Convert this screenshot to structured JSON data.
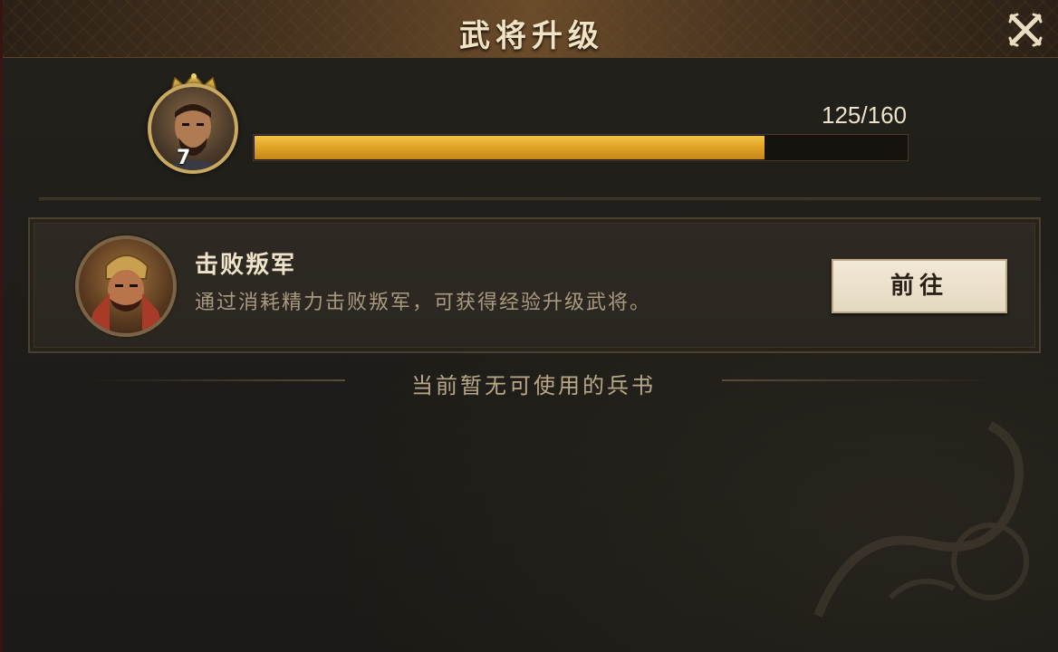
{
  "header": {
    "title": "武将升级"
  },
  "hero": {
    "level": "7",
    "exp_text": "125/160",
    "exp_current": 125,
    "exp_max": 160
  },
  "task": {
    "title": "击败叛军",
    "description": "通过消耗精力击败叛军，可获得经验升级武将。",
    "button_label": "前往"
  },
  "notice": {
    "text": "当前暂无可使用的兵书"
  },
  "colors": {
    "accent_gold": "#e2a626",
    "title_text": "#f1e3c4",
    "panel_bg": "#1f1d19"
  },
  "icons": {
    "close": "close-x-icon",
    "crown": "crown-icon"
  }
}
